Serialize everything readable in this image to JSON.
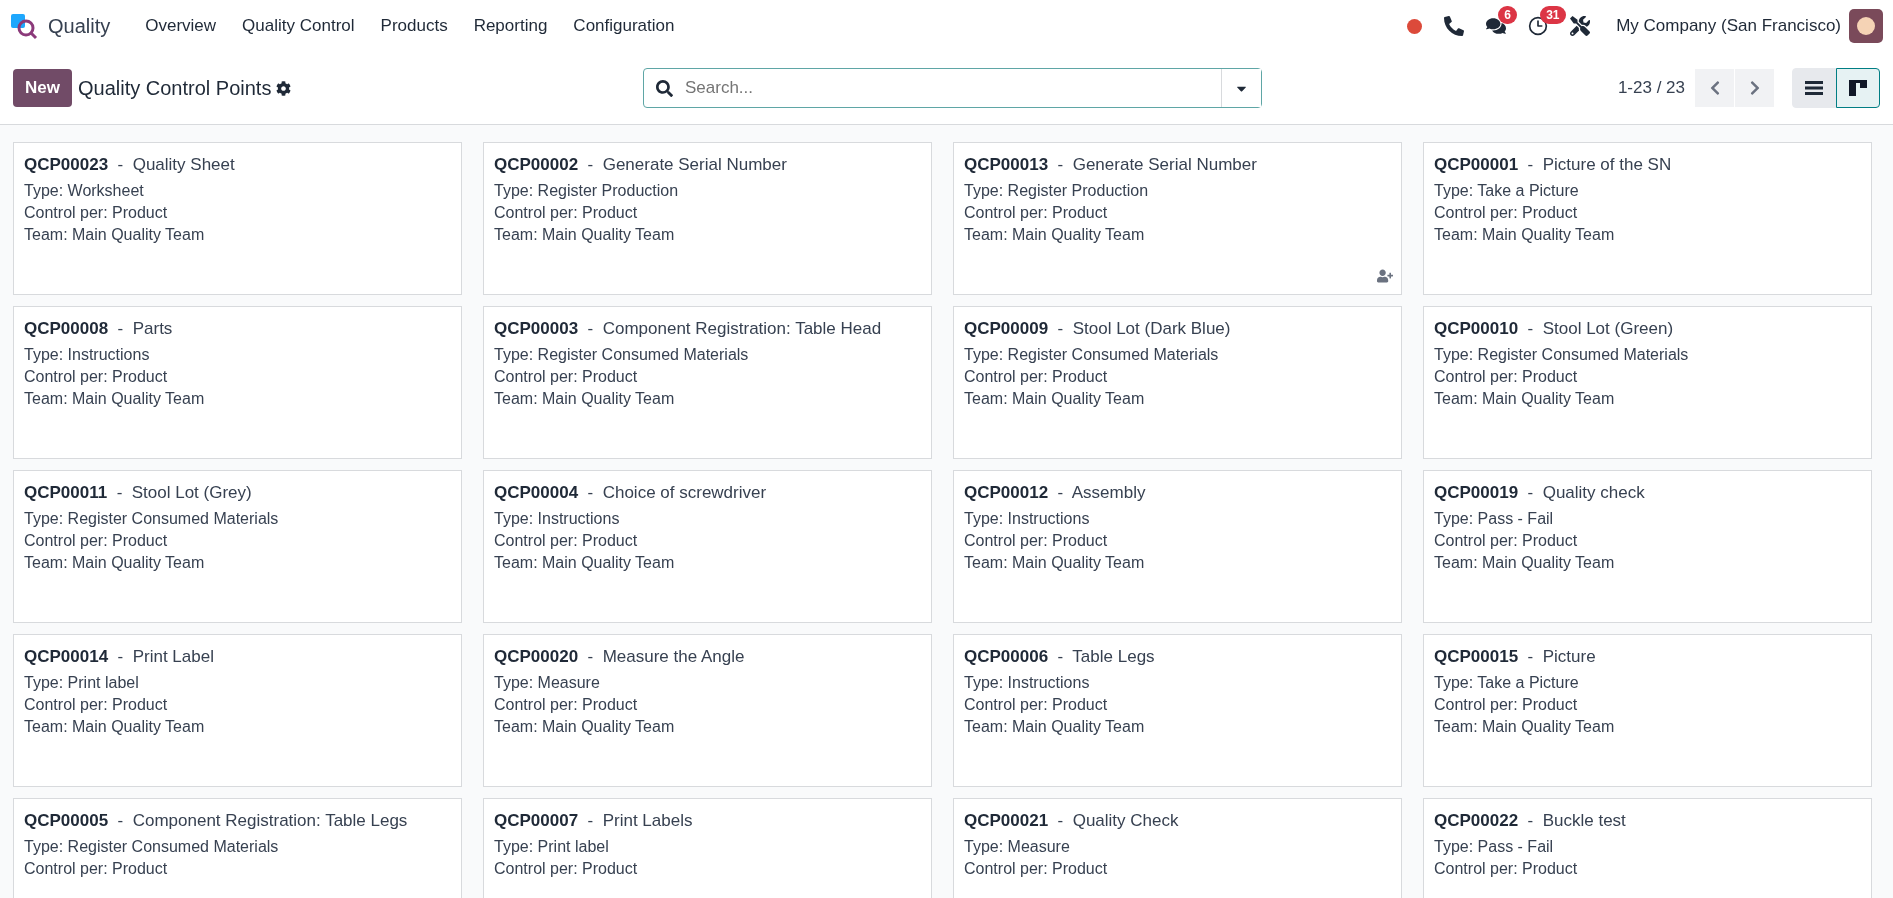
{
  "navbar": {
    "app_name": "Quality",
    "menu": [
      "Overview",
      "Quality Control",
      "Products",
      "Reporting",
      "Configuration"
    ],
    "messages_count": "6",
    "activities_count": "31",
    "company": "My Company (San Francisco)"
  },
  "control_panel": {
    "new_button": "New",
    "title": "Quality Control Points",
    "search": {
      "placeholder": "Search..."
    },
    "pager": "1-23 / 23",
    "views": [
      {
        "kind": "list",
        "selected": false
      },
      {
        "kind": "kanban",
        "selected": true
      }
    ]
  },
  "cards": [
    {
      "title": "**QCP00023**  -  Quality Sheet",
      "type": "Type: Worksheet",
      "control_per": "Control per: Product",
      "team": "Team: Main Quality Team"
    },
    {
      "title": "**QCP00002**  -  Generate Serial Number",
      "type": "Type: Register Production",
      "control_per": "Control per: Product",
      "team": "Team: Main Quality Team"
    },
    {
      "title": "**QCP00013**  -  Generate Serial Number",
      "type": "Type: Register Production",
      "control_per": "Control per: Product",
      "team": "Team: Main Quality Team",
      "actions": [
        {
          "kind": "add_follower"
        }
      ]
    },
    {
      "title": "**QCP00001**  -  Picture of the SN",
      "type": "Type: Take a Picture",
      "control_per": "Control per: Product",
      "team": "Team: Main Quality Team"
    },
    {
      "title": "**QCP00008**  -  Parts",
      "type": "Type: Instructions",
      "control_per": "Control per: Product",
      "team": "Team: Main Quality Team"
    },
    {
      "title": "**QCP00003**  -  Component Registration: Table Head",
      "type": "Type: Register Consumed Materials",
      "control_per": "Control per: Product",
      "team": "Team: Main Quality Team"
    },
    {
      "title": "**QCP00009**  -  Stool Lot (Dark Blue)",
      "type": "Type: Register Consumed Materials",
      "control_per": "Control per: Product",
      "team": "Team: Main Quality Team"
    },
    {
      "title": "**QCP00010**  -  Stool Lot (Green)",
      "type": "Type: Register Consumed Materials",
      "control_per": "Control per: Product",
      "team": "Team: Main Quality Team"
    },
    {
      "title": "**QCP00011**  -  Stool Lot (Grey)",
      "type": "Type: Register Consumed Materials",
      "control_per": "Control per: Product",
      "team": "Team: Main Quality Team"
    },
    {
      "title": "**QCP00004**  -  Choice of screwdriver",
      "type": "Type: Instructions",
      "control_per": "Control per: Product",
      "team": "Team: Main Quality Team"
    },
    {
      "title": "**QCP00012**  -  Assembly",
      "type": "Type: Instructions",
      "control_per": "Control per: Product",
      "team": "Team: Main Quality Team"
    },
    {
      "title": "**QCP00019**  -  Quality check",
      "type": "Type: Pass - Fail",
      "control_per": "Control per: Product",
      "team": "Team: Main Quality Team"
    },
    {
      "title": "**QCP00014**  -  Print Label",
      "type": "Type: Print label",
      "control_per": "Control per: Product",
      "team": "Team: Main Quality Team"
    },
    {
      "title": "**QCP00020**  -  Measure the Angle",
      "type": "Type: Measure",
      "control_per": "Control per: Product",
      "team": "Team: Main Quality Team"
    },
    {
      "title": "**QCP00006**  -  Table Legs",
      "type": "Type: Instructions",
      "control_per": "Control per: Product",
      "team": "Team: Main Quality Team"
    },
    {
      "title": "**QCP00015**  -  Picture",
      "type": "Type: Take a Picture",
      "control_per": "Control per: Product",
      "team": "Team: Main Quality Team"
    },
    {
      "title": "**QCP00005**  -  Component Registration: Table Legs",
      "type": "Type: Register Consumed Materials",
      "control_per": "Control per: Product"
    },
    {
      "title": "**QCP00007**  -  Print Labels",
      "type": "Type: Print label",
      "control_per": "Control per: Product"
    },
    {
      "title": "**QCP00021**  -  Quality Check",
      "type": "Type: Measure",
      "control_per": "Control per: Product"
    },
    {
      "title": "**QCP00022**  -  Buckle test",
      "type": "Type: Pass - Fail",
      "control_per": "Control per: Product"
    }
  ]
}
